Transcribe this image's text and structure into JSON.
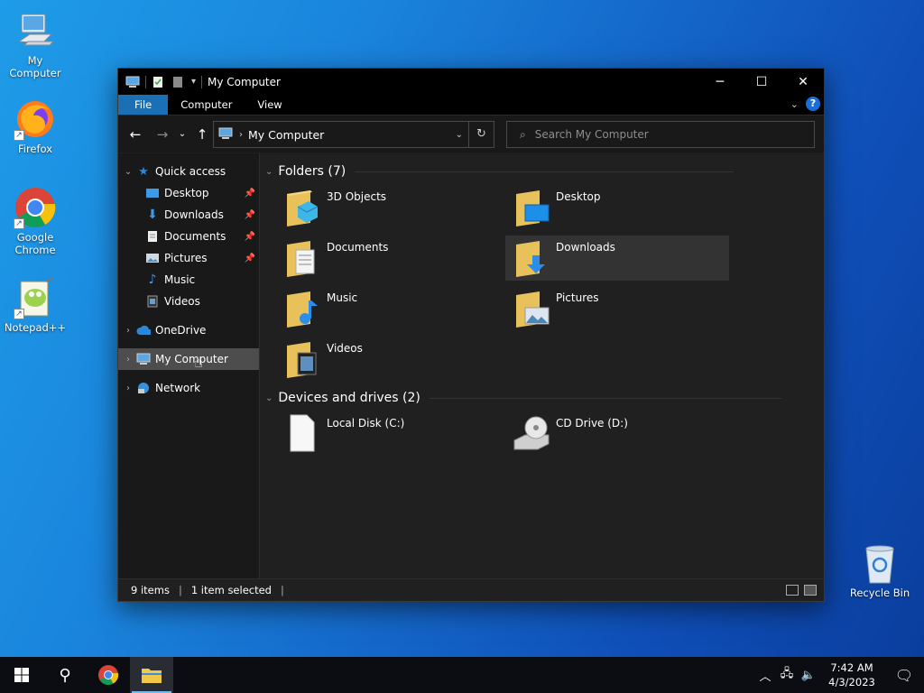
{
  "desktop": {
    "icons": [
      {
        "label": "My Computer",
        "icon": "computer-icon"
      },
      {
        "label": "Firefox",
        "icon": "firefox-icon"
      },
      {
        "label": "Google Chrome",
        "icon": "chrome-icon"
      },
      {
        "label": "Notepad++",
        "icon": "notepadpp-icon"
      },
      {
        "label": "Recycle Bin",
        "icon": "recycle-bin-icon"
      }
    ]
  },
  "window": {
    "title": "My Computer",
    "ribbon_tabs": [
      "File",
      "Computer",
      "View"
    ],
    "help_label": "?",
    "address": {
      "crumb": "My Computer"
    },
    "search": {
      "placeholder": "Search My Computer"
    },
    "nav_pane": {
      "quick_access": "Quick access",
      "quick_items": [
        {
          "label": "Desktop",
          "pinned": true
        },
        {
          "label": "Downloads",
          "pinned": true
        },
        {
          "label": "Documents",
          "pinned": true
        },
        {
          "label": "Pictures",
          "pinned": true
        },
        {
          "label": "Music",
          "pinned": false
        },
        {
          "label": "Videos",
          "pinned": false
        }
      ],
      "onedrive": "OneDrive",
      "my_computer": "My Computer",
      "network": "Network"
    },
    "folders_header": "Folders (7)",
    "folders": [
      {
        "name": "3D Objects"
      },
      {
        "name": "Desktop"
      },
      {
        "name": "Documents"
      },
      {
        "name": "Downloads"
      },
      {
        "name": "Music"
      },
      {
        "name": "Pictures"
      },
      {
        "name": "Videos"
      }
    ],
    "drives_header": "Devices and drives (2)",
    "drives": [
      {
        "name": "Local Disk (C:)"
      },
      {
        "name": "CD Drive (D:)"
      }
    ],
    "status": {
      "items": "9 items",
      "selected": "1 item selected"
    }
  },
  "taskbar": {
    "time": "7:42 AM",
    "date": "4/3/2023"
  },
  "colors": {
    "accent": "#1a6fb5",
    "window_bg": "#202020",
    "selected": "#4d4d4d"
  }
}
